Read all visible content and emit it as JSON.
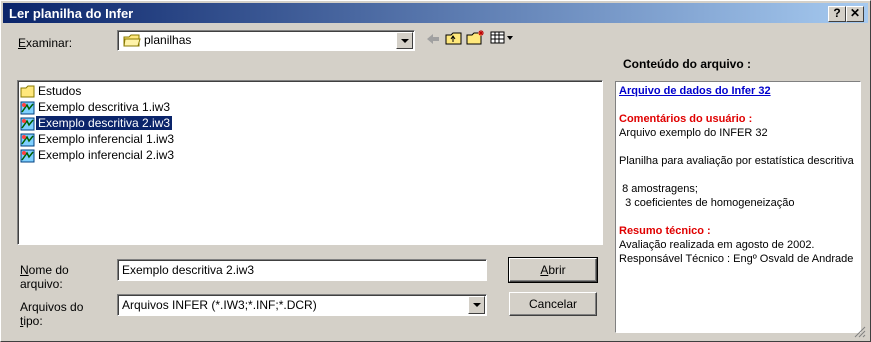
{
  "window": {
    "title": "Ler planilha do Infer",
    "help_label": "?",
    "close_label": "✕"
  },
  "toolbar": {
    "examinar_prefix": "E",
    "examinar_rest": "xaminar:",
    "folder": "planilhas",
    "back_icon": "back-arrow-icon",
    "up_icon": "folder-up-icon",
    "new_icon": "new-folder-icon",
    "view_icon": "view-menu-icon"
  },
  "files": [
    {
      "name": "Estudos",
      "type": "folder"
    },
    {
      "name": "Exemplo descritiva 1.iw3",
      "type": "iw3"
    },
    {
      "name": "Exemplo descritiva 2.iw3",
      "type": "iw3",
      "selected": true
    },
    {
      "name": "Exemplo inferencial 1.iw3",
      "type": "iw3"
    },
    {
      "name": "Exemplo inferencial 2.iw3",
      "type": "iw3"
    }
  ],
  "form": {
    "filename_label_u": "N",
    "filename_label_rest1": "ome do",
    "filename_label_rest2": "arquivo:",
    "filename_value": "Exemplo descritiva 2.iw3",
    "filetype_label1": "Arquivos do",
    "filetype_label_u": "t",
    "filetype_label_rest": "ipo:",
    "filetype_value": "Arquivos INFER (*.IW3;*.INF;*.DCR)"
  },
  "buttons": {
    "open_u": "A",
    "open_rest": "brir",
    "cancel": "Cancelar"
  },
  "preview": {
    "header": "Conteúdo do arquivo :",
    "link": "Arquivo de dados do Infer 32",
    "comments_heading": "Comentários do usuário :",
    "comments_line1": "Arquivo exemplo do INFER 32",
    "comments_line2": "Planilha para avaliação por estatística descritiva",
    "comments_line3": " 8 amostragens;\n  3 coeficientes de homogeneização",
    "summary_heading": "Resumo técnico :",
    "summary_text": "Avaliação realizada em agosto de 2002. Responsável Técnico : Engº Osvald de Andrade"
  }
}
